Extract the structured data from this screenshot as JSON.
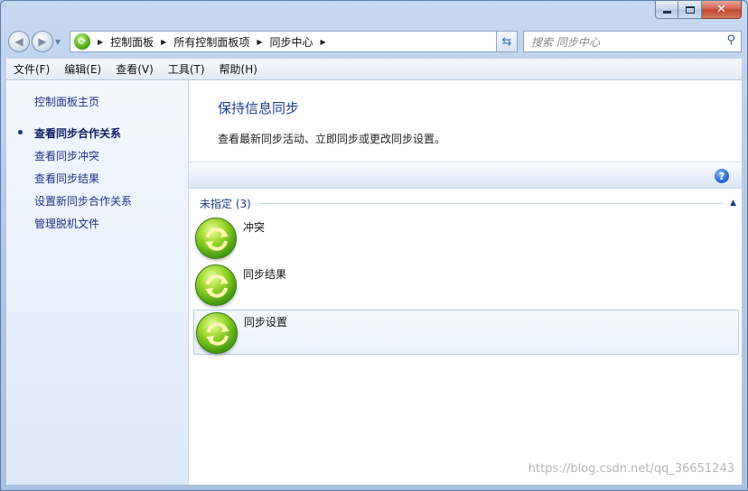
{
  "window": {
    "min_glyph": "",
    "close_glyph": "✕"
  },
  "address": {
    "crumbs": [
      "控制面板",
      "所有控制面板项",
      "同步中心"
    ]
  },
  "search": {
    "placeholder": "搜索 同步中心"
  },
  "menu": {
    "items": [
      "文件(F)",
      "编辑(E)",
      "查看(V)",
      "工具(T)",
      "帮助(H)"
    ]
  },
  "sidebar": {
    "home": "控制面板主页",
    "items": [
      "查看同步合作关系",
      "查看同步冲突",
      "查看同步结果",
      "设置新同步合作关系",
      "管理脱机文件"
    ]
  },
  "main": {
    "title": "保持信息同步",
    "subtitle": "查看最新同步活动、立即同步或更改同步设置。",
    "group_label": "未指定 (3)",
    "items": [
      "冲突",
      "同步结果",
      "同步设置"
    ]
  },
  "watermark": "https://blog.csdn.net/qq_36651243",
  "icons": {
    "help": "help-icon",
    "sync": "sync-icon",
    "search": "search-icon",
    "refresh": "refresh-icon"
  },
  "colors": {
    "link": "#1e3287",
    "title": "#1e3a8a",
    "sync_green": "#4aa012"
  }
}
